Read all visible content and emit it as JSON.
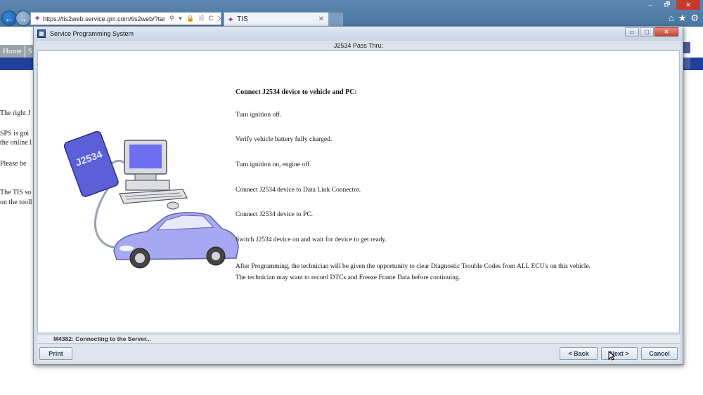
{
  "browser": {
    "address": "https://tis2web.service.gm.com/tis2web/?tar",
    "address_controls": "⚲ ▾ 🔒 🗎 C ✕",
    "tab_label": "TIS",
    "tab_close": "✕",
    "window_controls": [
      "–",
      "🗗",
      "✕"
    ],
    "tool_icons": [
      "⌂",
      "★",
      "⚙"
    ]
  },
  "background_page": {
    "tabs": [
      "Home",
      "S"
    ],
    "text_lines": [
      "The right J",
      "SPS is goi",
      "the online l",
      "Please be",
      "The TIS so",
      "on the tooll"
    ]
  },
  "dialog": {
    "title": "Service Programming System",
    "title_buttons": [
      "▭",
      "▢",
      "✕"
    ],
    "step_title": "J2534 Pass Thru:",
    "illustration_label": "J2534",
    "heading": "Connect J2534 device to vehicle and PC:",
    "instructions": [
      "Turn ignition off.",
      "Verify vehicle battery fully charged.",
      "Turn ignition on, engine off.",
      "Connect J2534 device to Data Link Connector.",
      "Connect J2534 device to PC.",
      "Switch J2534 device on and wait for device to get ready."
    ],
    "note_lines": [
      "After Programming, the technician will be given the opportunity to clear Diagnostic Trouble Codes from ALL ECU's on this vehicle.",
      "The technician may want to record DTCs and Freeze Frame Data before continuing."
    ],
    "status": "M4382: Connecting to the Server...",
    "buttons": {
      "print": "Print",
      "back": "< Back",
      "next": "Next >",
      "cancel": "Cancel"
    }
  }
}
